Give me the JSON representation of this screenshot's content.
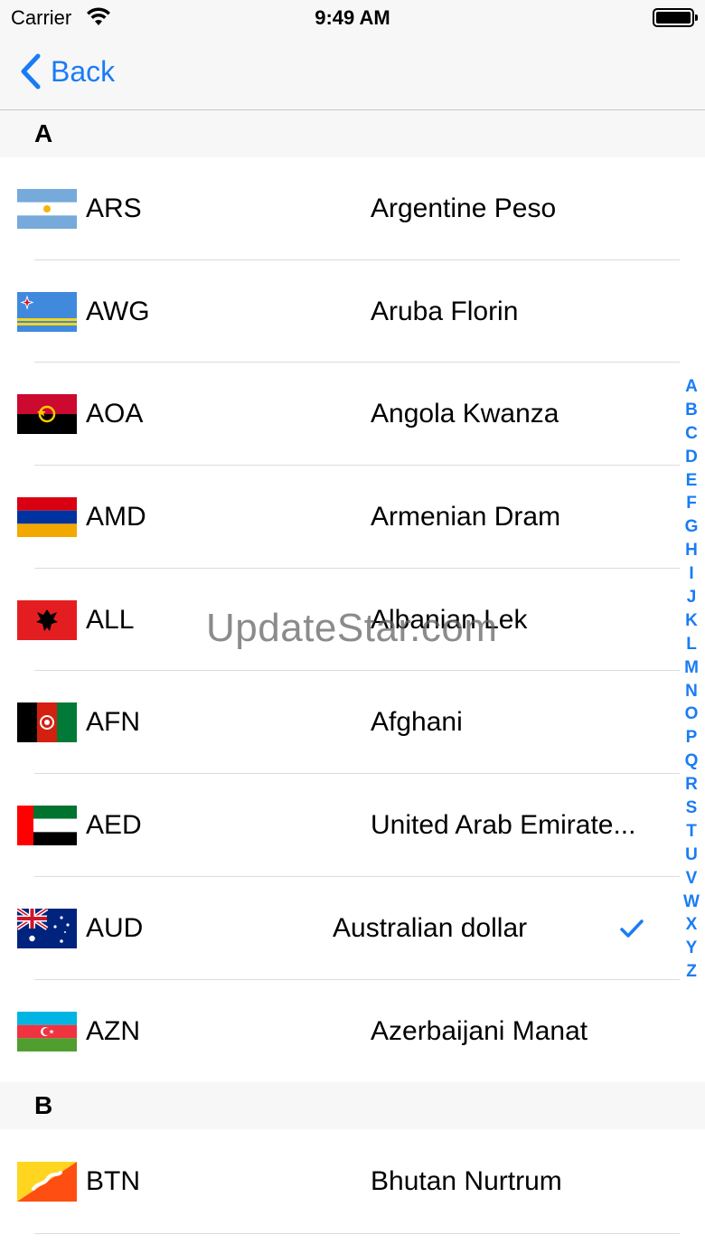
{
  "status_bar": {
    "carrier": "Carrier",
    "time": "9:49 AM",
    "wifi_icon": "wifi-icon",
    "battery_icon": "battery-icon"
  },
  "nav": {
    "back_label": "Back",
    "back_icon": "chevron-left-icon"
  },
  "sections": [
    {
      "title": "A",
      "rows": [
        {
          "code": "ARS",
          "name": "Argentine Peso",
          "flag": "argentina-flag-icon"
        },
        {
          "code": "AWG",
          "name": "Aruba Florin",
          "flag": "aruba-flag-icon"
        },
        {
          "code": "AOA",
          "name": "Angola Kwanza",
          "flag": "angola-flag-icon"
        },
        {
          "code": "AMD",
          "name": "Armenian Dram",
          "flag": "armenia-flag-icon"
        },
        {
          "code": "ALL",
          "name": "Albanian Lek",
          "flag": "albania-flag-icon"
        },
        {
          "code": "AFN",
          "name": "Afghani",
          "flag": "afghanistan-flag-icon"
        },
        {
          "code": "AED",
          "name": "United Arab Emirate...",
          "flag": "uae-flag-icon"
        },
        {
          "code": "AUD",
          "name": "Australian dollar",
          "flag": "australia-flag-icon",
          "selected": true
        },
        {
          "code": "AZN",
          "name": "Azerbaijani Manat",
          "flag": "azerbaijan-flag-icon"
        }
      ]
    },
    {
      "title": "B",
      "rows": [
        {
          "code": "BTN",
          "name": "Bhutan Nurtrum",
          "flag": "bhutan-flag-icon"
        }
      ]
    }
  ],
  "index_letters": [
    "A",
    "B",
    "C",
    "D",
    "E",
    "F",
    "G",
    "H",
    "I",
    "J",
    "K",
    "L",
    "M",
    "N",
    "O",
    "P",
    "Q",
    "R",
    "S",
    "T",
    "U",
    "V",
    "W",
    "X",
    "Y",
    "Z"
  ],
  "watermark": "UpdateStar.com",
  "colors": {
    "accent": "#1a7cf5",
    "header_bg": "#f7f7f7",
    "separator": "#dcdcdc"
  }
}
